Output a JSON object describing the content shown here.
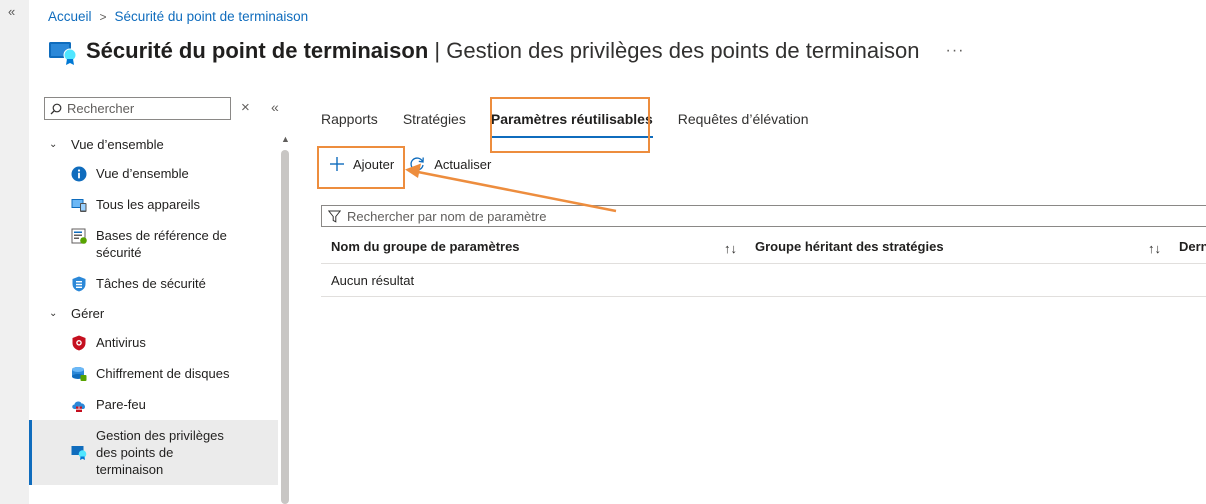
{
  "breadcrumb": {
    "home": "Accueil",
    "current": "Sécurité du point de terminaison"
  },
  "header": {
    "title_bold": "Sécurité du point de terminaison",
    "title_rest": " | Gestion des privilèges des points de terminaison",
    "more": "···"
  },
  "sidebar": {
    "search_placeholder": "Rechercher",
    "groups": [
      {
        "label": "Vue d’ensemble",
        "items": [
          {
            "label": "Vue d’ensemble",
            "icon": "info-icon"
          },
          {
            "label": "Tous les appareils",
            "icon": "devices-icon"
          },
          {
            "label": "Bases de référence de sécurité",
            "icon": "baseline-icon"
          },
          {
            "label": "Tâches de sécurité",
            "icon": "shield-tasks-icon"
          }
        ]
      },
      {
        "label": "Gérer",
        "items": [
          {
            "label": "Antivirus",
            "icon": "antivirus-icon"
          },
          {
            "label": "Chiffrement de disques",
            "icon": "disk-encryption-icon"
          },
          {
            "label": "Pare-feu",
            "icon": "firewall-icon"
          },
          {
            "label": "Gestion des privilèges des points de terminaison",
            "icon": "epm-icon"
          }
        ]
      }
    ]
  },
  "tabs": [
    "Rapports",
    "Stratégies",
    "Paramètres réutilisables",
    "Requêtes d’élévation"
  ],
  "toolbar": {
    "add_label": "Ajouter",
    "refresh_label": "Actualiser"
  },
  "filter": {
    "placeholder": "Rechercher par nom de paramètre"
  },
  "table": {
    "columns": [
      "Nom du groupe de paramètres",
      "Groupe héritant des stratégies",
      "Derni"
    ],
    "empty": "Aucun résultat"
  },
  "colors": {
    "accent": "#0f6cbd",
    "highlight": "#ed8d3e"
  }
}
